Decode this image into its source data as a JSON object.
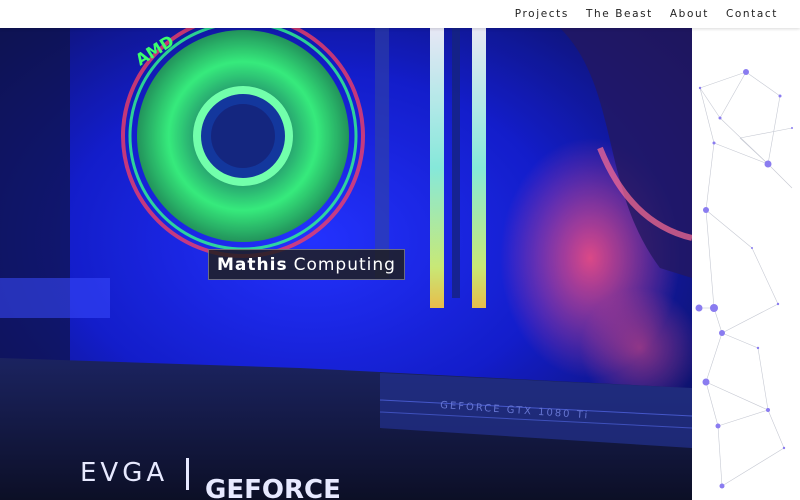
{
  "nav": {
    "items": [
      {
        "label": "Projects"
      },
      {
        "label": "The Beast"
      },
      {
        "label": "About"
      },
      {
        "label": "Contact"
      }
    ]
  },
  "hero": {
    "brand_strong": "Mathis",
    "brand_light": "Computing",
    "photo_text": {
      "cooler_brand": "AMD",
      "gpu_brand": "EVGA",
      "gpu_series": "GEFORCE",
      "gpu_model": "GEFORCE GTX 1080 Ti"
    }
  },
  "colors": {
    "accent_node": "#8a7cf0",
    "fan_green": "#33ff66",
    "hero_blue": "#0a1aff"
  }
}
